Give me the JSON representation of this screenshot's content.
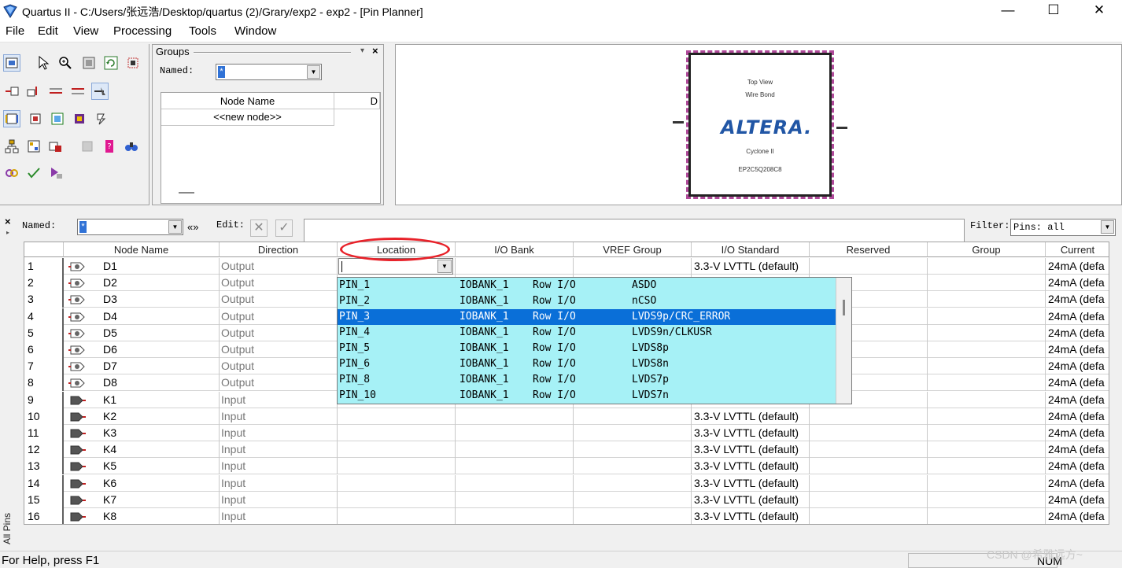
{
  "window": {
    "title": "Quartus II - C:/Users/张远浩/Desktop/quartus (2)/Grary/exp2 - exp2 - [Pin Planner]",
    "minimize": "—",
    "maximize": "☐",
    "close": "✕"
  },
  "menu": [
    "File",
    "Edit",
    "View",
    "Processing",
    "Tools",
    "Window"
  ],
  "groups": {
    "title": "Groups",
    "named_label": "Named:",
    "named_value": "*",
    "col_node_name": "Node Name",
    "col_d": "D",
    "new_node": "<<new node>>"
  },
  "chip": {
    "line1": "Top View",
    "line2": "Wire Bond",
    "logo": "ALTERA.",
    "family": "Cyclone II",
    "part": "EP2C5Q208C8"
  },
  "filterbar": {
    "named_label": "Named:",
    "named_value": "*",
    "expand": "«»",
    "edit_label": "Edit:",
    "cancel_glyph": "✕",
    "accept_glyph": "✓",
    "filter_label": "Filter:",
    "filter_value": "Pins: all"
  },
  "table": {
    "headers": [
      "Node Name",
      "Direction",
      "Location",
      "I/O Bank",
      "VREF Group",
      "I/O Standard",
      "Reserved",
      "Group",
      "Current"
    ],
    "rows": [
      {
        "num": "1",
        "name": "D1",
        "dir": "Output",
        "std": "",
        "cur": "24mA (defa"
      },
      {
        "num": "2",
        "name": "D2",
        "dir": "Output",
        "std": "",
        "cur": "24mA (defa"
      },
      {
        "num": "3",
        "name": "D3",
        "dir": "Output",
        "std": "",
        "cur": "24mA (defa"
      },
      {
        "num": "4",
        "name": "D4",
        "dir": "Output",
        "std": "",
        "cur": "24mA (defa"
      },
      {
        "num": "5",
        "name": "D5",
        "dir": "Output",
        "std": "",
        "cur": "24mA (defa"
      },
      {
        "num": "6",
        "name": "D6",
        "dir": "Output",
        "std": "",
        "cur": "24mA (defa"
      },
      {
        "num": "7",
        "name": "D7",
        "dir": "Output",
        "std": "",
        "cur": "24mA (defa"
      },
      {
        "num": "8",
        "name": "D8",
        "dir": "Output",
        "std": "",
        "cur": "24mA (defa"
      },
      {
        "num": "9",
        "name": "K1",
        "dir": "Input",
        "std": "",
        "cur": "24mA (defa"
      },
      {
        "num": "10",
        "name": "K2",
        "dir": "Input",
        "std": "3.3-V LVTTL (default)",
        "cur": "24mA (defa"
      },
      {
        "num": "11",
        "name": "K3",
        "dir": "Input",
        "std": "3.3-V LVTTL (default)",
        "cur": "24mA (defa"
      },
      {
        "num": "12",
        "name": "K4",
        "dir": "Input",
        "std": "3.3-V LVTTL (default)",
        "cur": "24mA (defa"
      },
      {
        "num": "13",
        "name": "K5",
        "dir": "Input",
        "std": "3.3-V LVTTL (default)",
        "cur": "24mA (defa"
      },
      {
        "num": "14",
        "name": "K6",
        "dir": "Input",
        "std": "3.3-V LVTTL (default)",
        "cur": "24mA (defa"
      },
      {
        "num": "15",
        "name": "K7",
        "dir": "Input",
        "std": "3.3-V LVTTL (default)",
        "cur": "24mA (defa"
      },
      {
        "num": "16",
        "name": "K8",
        "dir": "Input",
        "std": "3.3-V LVTTL (default)",
        "cur": "24mA (defa"
      }
    ],
    "row1_std": "3.3-V LVTTL (default)"
  },
  "location_dropdown": {
    "items": [
      {
        "pin": "PIN_1",
        "bank": "IOBANK_1",
        "type": "Row I/O",
        "func": "ASDO"
      },
      {
        "pin": "PIN_2",
        "bank": "IOBANK_1",
        "type": "Row I/O",
        "func": "nCSO"
      },
      {
        "pin": "PIN_3",
        "bank": "IOBANK_1",
        "type": "Row I/O",
        "func": "LVDS9p/CRC_ERROR"
      },
      {
        "pin": "PIN_4",
        "bank": "IOBANK_1",
        "type": "Row I/O",
        "func": "LVDS9n/CLKUSR"
      },
      {
        "pin": "PIN_5",
        "bank": "IOBANK_1",
        "type": "Row I/O",
        "func": "LVDS8p"
      },
      {
        "pin": "PIN_6",
        "bank": "IOBANK_1",
        "type": "Row I/O",
        "func": "LVDS8n"
      },
      {
        "pin": "PIN_8",
        "bank": "IOBANK_1",
        "type": "Row I/O",
        "func": "LVDS7p"
      },
      {
        "pin": "PIN_10",
        "bank": "IOBANK_1",
        "type": "Row I/O",
        "func": "LVDS7n"
      }
    ],
    "selected": "PIN_3"
  },
  "side_tab": "All Pins",
  "status": {
    "help": "For Help, press F1",
    "num": "NUM",
    "watermark": "CSDN @希雅远方~"
  },
  "colors": {
    "dropdown_bg": "#a6f1f6",
    "selection": "#0a6fd8",
    "annotation": "#e8222a",
    "logo": "#2156a5"
  }
}
